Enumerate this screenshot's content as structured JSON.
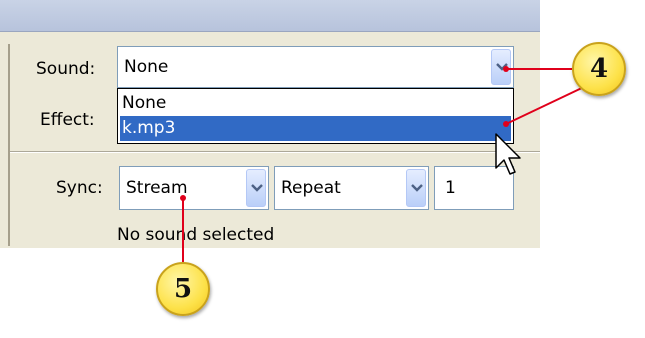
{
  "sound": {
    "label": "Sound:",
    "value": "None"
  },
  "effect": {
    "label": "Effect:"
  },
  "dropdown": {
    "options": [
      "None",
      "k.mp3"
    ],
    "highlighted": "k.mp3"
  },
  "sync": {
    "label": "Sync:",
    "mode": "Stream",
    "repeat": "Repeat",
    "count": "1"
  },
  "status": "No sound selected",
  "callouts": {
    "sound_arrow": "4",
    "sync_combo": "5"
  },
  "colors": {
    "panel": "#ece9d8",
    "selection": "#316ac5",
    "callout_fill": "#fde24a",
    "leader_line": "#e0001b"
  },
  "icons": [
    "chevron-down-icon",
    "mouse-pointer-icon"
  ]
}
